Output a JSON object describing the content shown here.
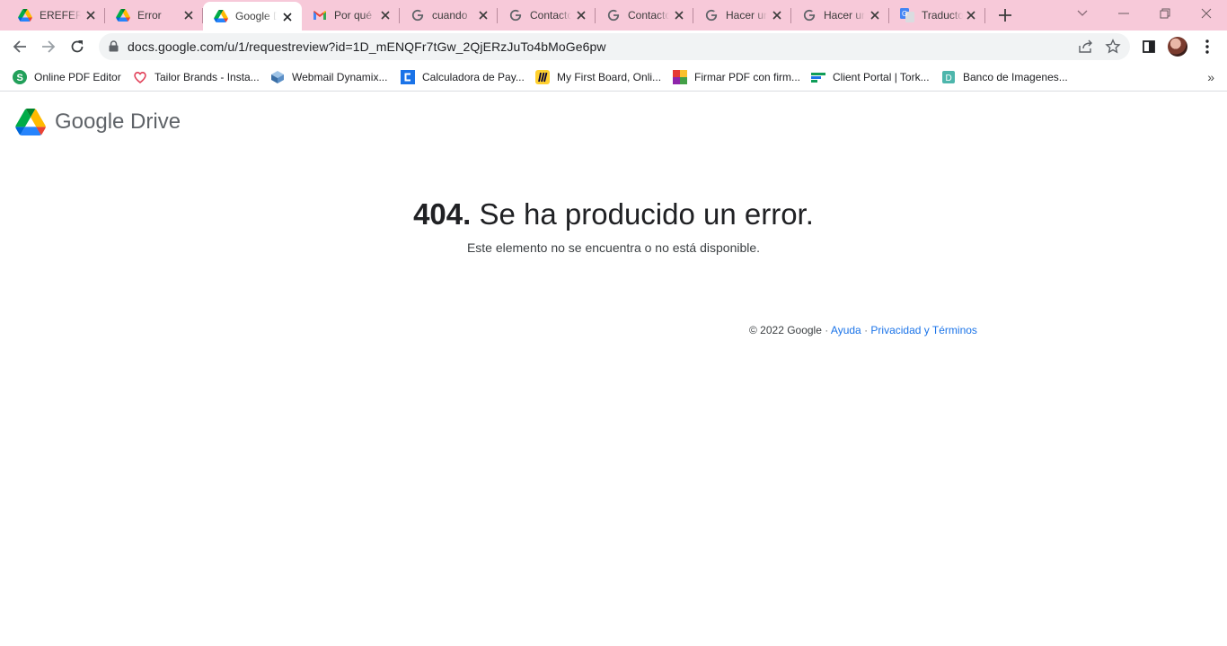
{
  "tabs": [
    {
      "title": "EREFERENCIAS",
      "icon": "google-drive-icon",
      "active": false
    },
    {
      "title": "Error",
      "icon": "google-drive-icon",
      "active": false
    },
    {
      "title": "Google Drive",
      "icon": "google-drive-icon",
      "active": true
    },
    {
      "title": "Por qué",
      "icon": "gmail-icon",
      "active": false
    },
    {
      "title": "cuando",
      "icon": "google-g-icon",
      "active": false
    },
    {
      "title": "Contacto",
      "icon": "google-g-icon",
      "active": false
    },
    {
      "title": "Contacto",
      "icon": "google-g-icon",
      "active": false
    },
    {
      "title": "Hacer un",
      "icon": "google-g-icon",
      "active": false
    },
    {
      "title": "Hacer un",
      "icon": "google-g-icon",
      "active": false
    },
    {
      "title": "Traductor",
      "icon": "google-translate-icon",
      "active": false
    }
  ],
  "toolbar": {
    "url": "docs.google.com/u/1/requestreview?id=1D_mENQFr7tGw_2QjERzJuTo4bMoGe6pw"
  },
  "bookmarks": [
    {
      "label": "Online PDF Editor",
      "icon": "sejda-icon",
      "color": "#22a05a"
    },
    {
      "label": "Tailor Brands - Insta...",
      "icon": "tailor-brands-icon",
      "color": "#e2445c"
    },
    {
      "label": "Webmail Dynamix...",
      "icon": "webmail-cube-icon",
      "color": "#3a6ea5"
    },
    {
      "label": "Calculadora de Pay...",
      "icon": "calculator-c-icon",
      "color": "#1a73e8"
    },
    {
      "label": "My First Board, Onli...",
      "icon": "miro-icon",
      "color": "#ffd02f"
    },
    {
      "label": "Firmar PDF con firm...",
      "icon": "rainbow-square-icon",
      "color": "#e53935"
    },
    {
      "label": "Client Portal | Tork...",
      "icon": "client-portal-icon",
      "color": "#0f9d58"
    },
    {
      "label": "Banco de Imagenes...",
      "icon": "banco-d-icon",
      "color": "#4db6ac"
    }
  ],
  "page": {
    "brand": "Google Drive",
    "error_code": "404.",
    "error_message": "Se ha producido un error.",
    "error_detail": "Este elemento no se encuentra o no está disponible.",
    "footer_copyright": "© 2022 Google",
    "footer_sep": "·",
    "footer_help": "Ayuda",
    "footer_privacy": "Privacidad y Términos"
  }
}
